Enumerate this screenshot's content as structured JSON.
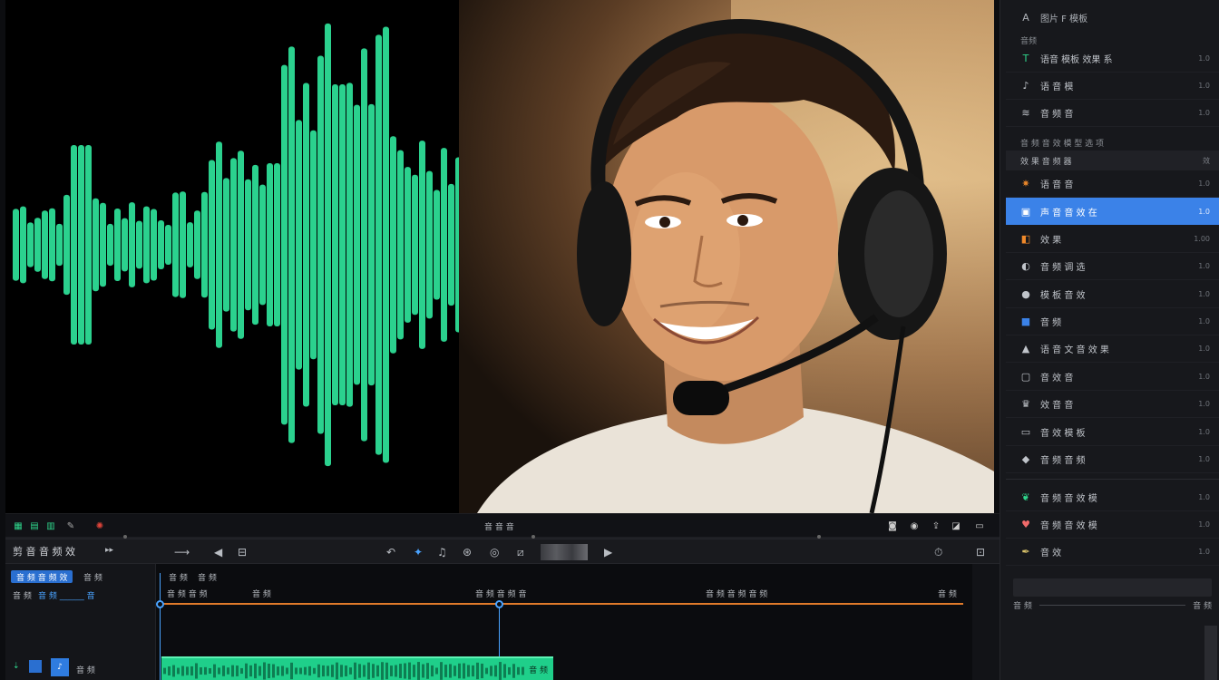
{
  "colors": {
    "accent": "#3b82e8",
    "wave": "#2fe39a",
    "clip": "#1fcf8a",
    "playhead": "#4aa3ff",
    "range": "#e07a2a"
  },
  "viewer": {
    "waveform_icon": "audio-waveform-overlay"
  },
  "panel": {
    "header": "图片 F 模板",
    "subheader": "音频",
    "top_items": [
      {
        "label": "语音 模板 效果 系",
        "meta": "1.0",
        "icon": "text-effect-icon"
      },
      {
        "label": "语 音 模",
        "meta": "1.0",
        "icon": "music-icon"
      },
      {
        "label": "音 频 音",
        "meta": "1.0",
        "icon": "wave-icon"
      }
    ],
    "top_note": "音 频 音 效 模 型 选 项",
    "section_label": "效 果 音 频 器",
    "section_meta": "效",
    "items": [
      {
        "label": "语 音 音",
        "meta": "1.0",
        "icon": "spark-icon"
      },
      {
        "label": "声 音 音 效 在",
        "meta": "1.0",
        "icon": "selected-icon"
      },
      {
        "label": "效 果",
        "meta": "1.00",
        "icon": "orange-icon"
      },
      {
        "label": "音 频 调 选",
        "meta": "1.0",
        "icon": "speaker-icon"
      },
      {
        "label": "模 板 音 效",
        "meta": "1.0",
        "icon": "record-icon"
      },
      {
        "label": "音 频",
        "meta": "1.0",
        "icon": "square-icon"
      },
      {
        "label": "语 音 文 音 效 果",
        "meta": "1.0",
        "icon": "triangle-icon"
      },
      {
        "label": "音 效 音",
        "meta": "1.0",
        "icon": "box-icon"
      },
      {
        "label": "效 音 音",
        "meta": "1.0",
        "icon": "crown-icon"
      },
      {
        "label": "音 效 模 板",
        "meta": "1.0",
        "icon": "frame-icon"
      },
      {
        "label": "音 频 音 频",
        "meta": "1.0",
        "icon": "dot-icon"
      }
    ],
    "lower_items": [
      {
        "label": "音 频 音 效 模",
        "meta": "1.0",
        "icon": "leaf-icon"
      },
      {
        "label": "音 频 音 效 模",
        "meta": "1.0",
        "icon": "shield-icon"
      },
      {
        "label": "音 效",
        "meta": "1.0",
        "icon": "feather-icon"
      }
    ],
    "footer_left": "音 频",
    "footer_right": "音 频"
  },
  "transport": {
    "center_label": "音 音 音"
  },
  "toolbar": {
    "title": "剪 音 音 频 效"
  },
  "timeline": {
    "chip_label": "音 频 音 频 效",
    "left_row1_a": "音 频",
    "left_row1_b": "音 频",
    "left_row2": "音 频 ______ 音",
    "ruler_top_a": "音 频",
    "ruler_top_b": "音 频",
    "marks": [
      "音 频 音 频",
      "音 频",
      "音 频 音 频 音",
      "音 频 音 频 音 频",
      "音 频"
    ],
    "track_label": "音 频",
    "clip_label": "音 频"
  }
}
